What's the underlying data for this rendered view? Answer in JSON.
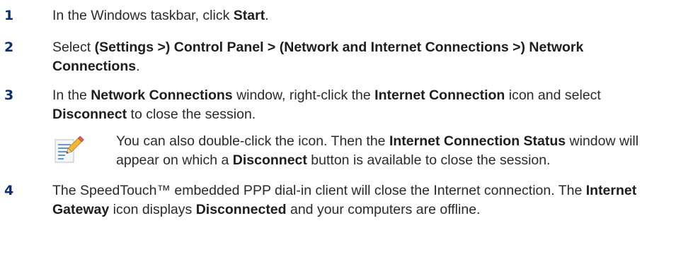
{
  "steps": [
    {
      "number": "1",
      "segments": [
        {
          "t": "In the Windows taskbar, click ",
          "b": false
        },
        {
          "t": "Start",
          "b": true
        },
        {
          "t": ".",
          "b": false
        }
      ]
    },
    {
      "number": "2",
      "segments": [
        {
          "t": "Select ",
          "b": false
        },
        {
          "t": "(Settings >) Control Panel > (Network and Internet Connections >) Network Connections",
          "b": true
        },
        {
          "t": ".",
          "b": false
        }
      ]
    },
    {
      "number": "3",
      "segments": [
        {
          "t": "In the ",
          "b": false
        },
        {
          "t": "Network Connections",
          "b": true
        },
        {
          "t": " window, right-click the ",
          "b": false
        },
        {
          "t": "Internet Connection",
          "b": true
        },
        {
          "t": " icon and select ",
          "b": false
        },
        {
          "t": "Disconnect",
          "b": true
        },
        {
          "t": " to close the session.",
          "b": false
        }
      ]
    },
    {
      "number": "4",
      "segments": [
        {
          "t": "The SpeedTouch™ embedded PPP dial-in client will close the Internet connection. The ",
          "b": false
        },
        {
          "t": "Internet Gateway",
          "b": true
        },
        {
          "t": " icon displays ",
          "b": false
        },
        {
          "t": "Disconnected",
          "b": true
        },
        {
          "t": " and your computers are offline.",
          "b": false
        }
      ]
    }
  ],
  "note": {
    "icon": "note-pencil-icon",
    "segments": [
      {
        "t": "You can also double-click the icon. Then the ",
        "b": false
      },
      {
        "t": "Internet Connection Status",
        "b": true
      },
      {
        "t": " window will appear on which a ",
        "b": false
      },
      {
        "t": "Disconnect",
        "b": true
      },
      {
        "t": " button is available to close the session.",
        "b": false
      }
    ]
  }
}
